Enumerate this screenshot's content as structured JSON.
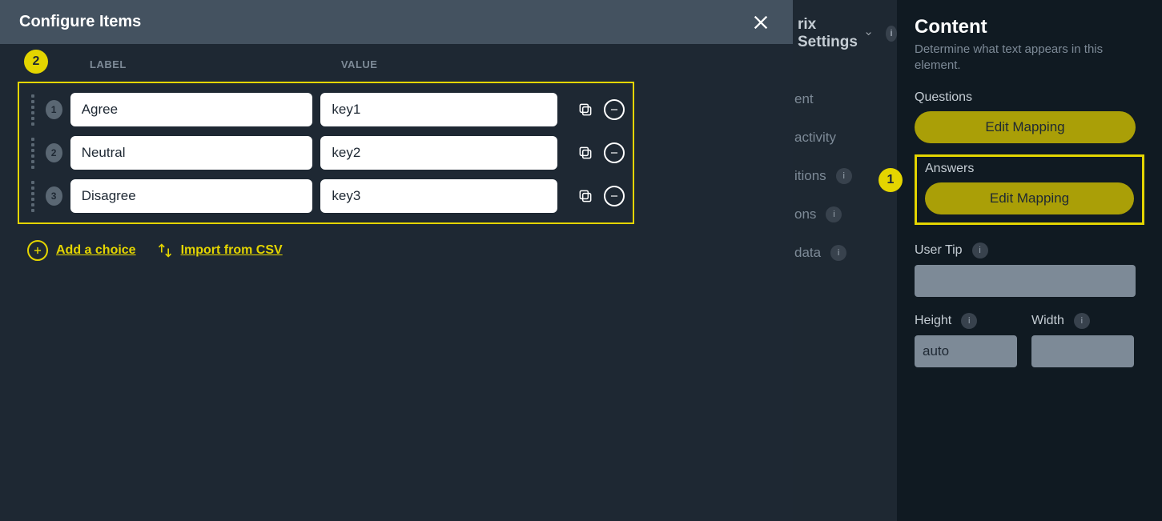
{
  "modal": {
    "title": "Configure Items",
    "columns": {
      "label": "LABEL",
      "value": "VALUE"
    },
    "callout2": "2",
    "items": [
      {
        "num": "1",
        "label": "Agree",
        "value": "key1"
      },
      {
        "num": "2",
        "label": "Neutral",
        "value": "key2"
      },
      {
        "num": "3",
        "label": "Disagree",
        "value": "key3"
      }
    ],
    "add_choice_label": "Add a choice",
    "import_csv_label": "Import from CSV"
  },
  "bg": {
    "settings_label": "rix Settings",
    "items": [
      {
        "text": "ent",
        "info": false
      },
      {
        "text": "activity",
        "info": false
      },
      {
        "text": "itions",
        "info": true
      },
      {
        "text": "ons",
        "info": true
      },
      {
        "text": "data",
        "info": true
      }
    ]
  },
  "panel": {
    "title": "Content",
    "subtitle": "Determine what text appears in this element.",
    "questions_label": "Questions",
    "questions_btn": "Edit Mapping",
    "callout1": "1",
    "answers_label": "Answers",
    "answers_btn": "Edit Mapping",
    "user_tip_label": "User Tip",
    "user_tip_value": "",
    "height_label": "Height",
    "height_value": "auto",
    "width_label": "Width",
    "width_value": ""
  }
}
